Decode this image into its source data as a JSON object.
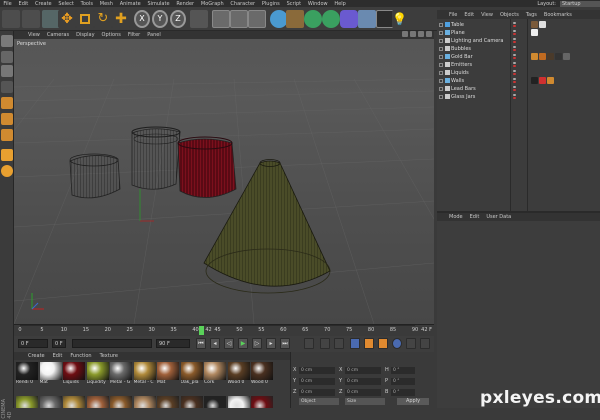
{
  "menubar": {
    "items": [
      "File",
      "Edit",
      "Create",
      "Select",
      "Tools",
      "Mesh",
      "Animate",
      "Simulate",
      "Render",
      "MoGraph",
      "Character",
      "Plugins",
      "Script",
      "Window",
      "Help"
    ],
    "layout_label": "Layout:",
    "layout_value": "Startup"
  },
  "object_manager": {
    "menu": [
      "File",
      "Edit",
      "View",
      "Objects",
      "Tags",
      "Bookmarks"
    ],
    "objects": [
      {
        "name": "Table",
        "icon": "#4fa0e0"
      },
      {
        "name": "Plane",
        "icon": "#6ab0e0"
      },
      {
        "name": "Lighting and Camera",
        "icon": "#cccccc"
      },
      {
        "name": "Bubbles",
        "icon": "#cccccc"
      },
      {
        "name": "Gold Bar",
        "icon": "#6ab0e0"
      },
      {
        "name": "Emitters",
        "icon": "#cccccc"
      },
      {
        "name": "Liquids",
        "icon": "#cccccc"
      },
      {
        "name": "Walls",
        "icon": "#6ab0e0"
      },
      {
        "name": "Lead Bars",
        "icon": "#cccccc"
      },
      {
        "name": "Glass Jars",
        "icon": "#cccccc"
      }
    ]
  },
  "attributes": {
    "menu": [
      "Mode",
      "Edit",
      "User Data"
    ]
  },
  "viewport": {
    "menu": [
      "View",
      "Cameras",
      "Display",
      "Options",
      "Filter",
      "Panel"
    ],
    "label": "Perspective"
  },
  "timeline": {
    "ticks": [
      "0",
      "5",
      "10",
      "15",
      "20",
      "25",
      "30",
      "35",
      "40",
      "45",
      "50",
      "55",
      "60",
      "65",
      "70",
      "75",
      "80",
      "85",
      "90"
    ],
    "current_frame_marker": "42",
    "end_label": "42 F"
  },
  "transport": {
    "start": "0 F",
    "current": "0 F",
    "max": "90 F",
    "end": "90 F"
  },
  "materials": {
    "menu": [
      "Create",
      "Edit",
      "Function",
      "Texture"
    ],
    "items": [
      {
        "label": "Rendi 0",
        "color": "#222222"
      },
      {
        "label": "Mat",
        "color": "#f2f2f2"
      },
      {
        "label": "Liquids",
        "color": "#6e0d12"
      },
      {
        "label": "Liquidity",
        "color": "#8a9a2a"
      },
      {
        "label": "Metal - G",
        "color": "#6a6a6a"
      },
      {
        "label": "Metal - C",
        "color": "#b08a3a"
      },
      {
        "label": "Mat",
        "color": "#a0603a"
      },
      {
        "label": "Oak_pla",
        "color": "#8a5a2a"
      },
      {
        "label": "Cork",
        "color": "#b08860"
      },
      {
        "label": "Wood 0",
        "color": "#5a3e24"
      },
      {
        "label": "Wood 0",
        "color": "#4a3020"
      }
    ]
  },
  "coordinates": {
    "x": "0 cm",
    "y": "0 cm",
    "z": "0 cm",
    "sx": "0 cm",
    "sy": "0 cm",
    "sz": "0 cm",
    "h": "0 °",
    "p": "0 °",
    "b": "0 °",
    "mode": "Object",
    "size_mode": "Size",
    "apply": "Apply"
  },
  "brand": {
    "watermark": "pxleyes.com",
    "app": "CINEMA 4D"
  }
}
